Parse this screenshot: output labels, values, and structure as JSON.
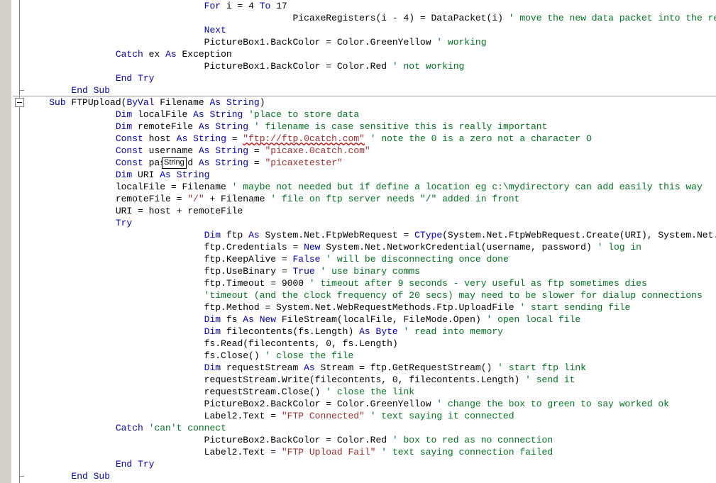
{
  "editor": {
    "language": "Visual Basic .NET",
    "gutter": {
      "indicator_margin_color": "#d4d0c8",
      "outline_rail_color": "#808080",
      "collapse_glyph": "minus-box"
    },
    "colors": {
      "background": "#ffffff",
      "keyword": "#0000C0",
      "comment": "#00731F",
      "string": "#9B2D2D",
      "identifier": "#000000",
      "error_squiggle": "#C00000",
      "separator": "#a0a0a0"
    }
  },
  "tooltip": {
    "text": "String",
    "kind": "quick-info"
  },
  "lines": [
    {
      "indent": 8,
      "tokens": [
        {
          "t": "For",
          "c": "kw"
        },
        {
          "t": " i = ",
          "c": "plain"
        },
        {
          "t": "4",
          "c": "plain"
        },
        {
          "t": " ",
          "c": "plain"
        },
        {
          "t": "To",
          "c": "kw"
        },
        {
          "t": " 17",
          "c": "plain"
        }
      ]
    },
    {
      "indent": 12,
      "tokens": [
        {
          "t": "PicaxeRegisters(i - 4) = DataPacket(i) ",
          "c": "plain"
        },
        {
          "t": "' move the new data packet into the register array",
          "c": "cmt"
        }
      ]
    },
    {
      "indent": 8,
      "tokens": [
        {
          "t": "Next",
          "c": "kw"
        }
      ]
    },
    {
      "indent": 8,
      "tokens": [
        {
          "t": "PictureBox1.BackColor = Color.GreenYellow ",
          "c": "plain"
        },
        {
          "t": "' working",
          "c": "cmt"
        }
      ]
    },
    {
      "indent": 4,
      "tokens": [
        {
          "t": "Catch",
          "c": "kw"
        },
        {
          "t": " ex ",
          "c": "plain"
        },
        {
          "t": "As",
          "c": "kw"
        },
        {
          "t": " Exception",
          "c": "plain"
        }
      ]
    },
    {
      "indent": 8,
      "tokens": [
        {
          "t": "PictureBox1.BackColor = Color.Red ",
          "c": "plain"
        },
        {
          "t": "' not working",
          "c": "cmt"
        }
      ]
    },
    {
      "indent": 4,
      "tokens": [
        {
          "t": "End Try",
          "c": "kw"
        }
      ]
    },
    {
      "indent": 2,
      "tokens": [
        {
          "t": "End Sub",
          "c": "kw"
        }
      ]
    },
    {
      "indent": 1,
      "tokens": [
        {
          "t": "Sub",
          "c": "kw"
        },
        {
          "t": " FTPUpload(",
          "c": "plain"
        },
        {
          "t": "ByVal",
          "c": "kw"
        },
        {
          "t": " Filename ",
          "c": "plain"
        },
        {
          "t": "As",
          "c": "kw"
        },
        {
          "t": " ",
          "c": "plain"
        },
        {
          "t": "String",
          "c": "kw"
        },
        {
          "t": ")",
          "c": "plain"
        }
      ]
    },
    {
      "indent": 4,
      "tokens": [
        {
          "t": "Dim",
          "c": "kw"
        },
        {
          "t": " localFile ",
          "c": "plain"
        },
        {
          "t": "As",
          "c": "kw"
        },
        {
          "t": " ",
          "c": "plain"
        },
        {
          "t": "String",
          "c": "kw"
        },
        {
          "t": " ",
          "c": "plain"
        },
        {
          "t": "'place to store data",
          "c": "cmt"
        }
      ]
    },
    {
      "indent": 4,
      "tokens": [
        {
          "t": "Dim",
          "c": "kw"
        },
        {
          "t": " remoteFile ",
          "c": "plain"
        },
        {
          "t": "As",
          "c": "kw"
        },
        {
          "t": " ",
          "c": "plain"
        },
        {
          "t": "String",
          "c": "kw"
        },
        {
          "t": " ",
          "c": "plain"
        },
        {
          "t": "' filename is case sensitive this is really important",
          "c": "cmt"
        }
      ]
    },
    {
      "indent": 4,
      "tokens": [
        {
          "t": "Const",
          "c": "kw"
        },
        {
          "t": " host ",
          "c": "plain"
        },
        {
          "t": "As",
          "c": "kw"
        },
        {
          "t": " ",
          "c": "plain"
        },
        {
          "t": "String",
          "c": "kw"
        },
        {
          "t": " = ",
          "c": "plain"
        },
        {
          "t": "\"ftp://ftp.0catch.com\"",
          "c": "str",
          "err": true
        },
        {
          "t": " ",
          "c": "plain"
        },
        {
          "t": "' note the 0 is a zero not a character O",
          "c": "cmt"
        }
      ]
    },
    {
      "indent": 4,
      "tokens": [
        {
          "t": "Const",
          "c": "kw"
        },
        {
          "t": " username ",
          "c": "plain"
        },
        {
          "t": "As",
          "c": "kw"
        },
        {
          "t": " ",
          "c": "plain"
        },
        {
          "t": "String",
          "c": "kw"
        },
        {
          "t": " = ",
          "c": "plain"
        },
        {
          "t": "\"picaxe.0catch.com\"",
          "c": "str"
        }
      ]
    },
    {
      "indent": 4,
      "tokens": [
        {
          "t": "Const",
          "c": "kw"
        },
        {
          "t": " password ",
          "c": "plain"
        },
        {
          "t": "As",
          "c": "kw"
        },
        {
          "t": " ",
          "c": "plain"
        },
        {
          "t": "String",
          "c": "kw"
        },
        {
          "t": " = ",
          "c": "plain"
        },
        {
          "t": "\"picaxetester\"",
          "c": "str"
        }
      ]
    },
    {
      "indent": 4,
      "tokens": [
        {
          "t": "Dim",
          "c": "kw"
        },
        {
          "t": " URI ",
          "c": "plain"
        },
        {
          "t": "As",
          "c": "kw"
        },
        {
          "t": " ",
          "c": "plain"
        },
        {
          "t": "String",
          "c": "kw"
        }
      ]
    },
    {
      "indent": 4,
      "tokens": [
        {
          "t": "localFile = Filename ",
          "c": "plain"
        },
        {
          "t": "' maybe not needed but if define a location eg c:\\mydirectory can add easily this way",
          "c": "cmt"
        }
      ]
    },
    {
      "indent": 4,
      "tokens": [
        {
          "t": "remoteFile = ",
          "c": "plain"
        },
        {
          "t": "\"/\"",
          "c": "str"
        },
        {
          "t": " + Filename ",
          "c": "plain"
        },
        {
          "t": "' file on ftp server needs \"/\" added in front",
          "c": "cmt"
        }
      ]
    },
    {
      "indent": 4,
      "tokens": [
        {
          "t": "URI = host + remoteFile",
          "c": "plain"
        }
      ]
    },
    {
      "indent": 4,
      "tokens": [
        {
          "t": "Try",
          "c": "kw"
        }
      ]
    },
    {
      "indent": 8,
      "tokens": [
        {
          "t": "Dim",
          "c": "kw"
        },
        {
          "t": " ftp ",
          "c": "plain"
        },
        {
          "t": "As",
          "c": "kw"
        },
        {
          "t": " System.Net.FtpWebRequest = ",
          "c": "plain"
        },
        {
          "t": "CType",
          "c": "kw"
        },
        {
          "t": "(System.Net.FtpWebRequest.Create(URI), System.Net.FtpWebRequest)",
          "c": "plain"
        }
      ]
    },
    {
      "indent": 8,
      "tokens": [
        {
          "t": "ftp.Credentials = ",
          "c": "plain"
        },
        {
          "t": "New",
          "c": "kw"
        },
        {
          "t": " System.Net.NetworkCredential(username, password) ",
          "c": "plain"
        },
        {
          "t": "' log in",
          "c": "cmt"
        }
      ]
    },
    {
      "indent": 8,
      "tokens": [
        {
          "t": "ftp.KeepAlive = ",
          "c": "plain"
        },
        {
          "t": "False",
          "c": "kw"
        },
        {
          "t": " ",
          "c": "plain"
        },
        {
          "t": "' will be disconnecting once done",
          "c": "cmt"
        }
      ]
    },
    {
      "indent": 8,
      "tokens": [
        {
          "t": "ftp.UseBinary = ",
          "c": "plain"
        },
        {
          "t": "True",
          "c": "kw"
        },
        {
          "t": " ",
          "c": "plain"
        },
        {
          "t": "' use binary comms",
          "c": "cmt"
        }
      ]
    },
    {
      "indent": 8,
      "tokens": [
        {
          "t": "ftp.Timeout = 9000 ",
          "c": "plain"
        },
        {
          "t": "' timeout after 9 seconds - very useful as ftp sometimes dies",
          "c": "cmt"
        }
      ]
    },
    {
      "indent": 8,
      "tokens": [
        {
          "t": "'timeout (and the clock frequency of 20 secs) may need to be slower for dialup connections",
          "c": "cmt"
        }
      ]
    },
    {
      "indent": 8,
      "tokens": [
        {
          "t": "ftp.Method = System.Net.WebRequestMethods.Ftp.UploadFile ",
          "c": "plain"
        },
        {
          "t": "' start sending file",
          "c": "cmt"
        }
      ]
    },
    {
      "indent": 8,
      "tokens": [
        {
          "t": "Dim",
          "c": "kw"
        },
        {
          "t": " fs ",
          "c": "plain"
        },
        {
          "t": "As",
          "c": "kw"
        },
        {
          "t": " ",
          "c": "plain"
        },
        {
          "t": "New",
          "c": "kw"
        },
        {
          "t": " FileStream(localFile, FileMode.Open) ",
          "c": "plain"
        },
        {
          "t": "' open local file",
          "c": "cmt"
        }
      ]
    },
    {
      "indent": 8,
      "tokens": [
        {
          "t": "Dim",
          "c": "kw"
        },
        {
          "t": " filecontents(fs.Length) ",
          "c": "plain"
        },
        {
          "t": "As",
          "c": "kw"
        },
        {
          "t": " ",
          "c": "plain"
        },
        {
          "t": "Byte",
          "c": "kw"
        },
        {
          "t": " ",
          "c": "plain"
        },
        {
          "t": "' read into memory",
          "c": "cmt"
        }
      ]
    },
    {
      "indent": 8,
      "tokens": [
        {
          "t": "fs.Read(filecontents, 0, fs.Length)",
          "c": "plain"
        }
      ]
    },
    {
      "indent": 8,
      "tokens": [
        {
          "t": "fs.Close() ",
          "c": "plain"
        },
        {
          "t": "' close the file",
          "c": "cmt"
        }
      ]
    },
    {
      "indent": 8,
      "tokens": [
        {
          "t": "Dim",
          "c": "kw"
        },
        {
          "t": " requestStream ",
          "c": "plain"
        },
        {
          "t": "As",
          "c": "kw"
        },
        {
          "t": " Stream = ftp.GetRequestStream() ",
          "c": "plain"
        },
        {
          "t": "' start ftp link",
          "c": "cmt"
        }
      ]
    },
    {
      "indent": 8,
      "tokens": [
        {
          "t": "requestStream.Write(filecontents, 0, filecontents.Length) ",
          "c": "plain"
        },
        {
          "t": "' send it",
          "c": "cmt"
        }
      ]
    },
    {
      "indent": 8,
      "tokens": [
        {
          "t": "requestStream.Close() ",
          "c": "plain"
        },
        {
          "t": "' close the link",
          "c": "cmt"
        }
      ]
    },
    {
      "indent": 8,
      "tokens": [
        {
          "t": "PictureBox2.BackColor = Color.GreenYellow ",
          "c": "plain"
        },
        {
          "t": "' change the box to green to say worked ok",
          "c": "cmt"
        }
      ]
    },
    {
      "indent": 8,
      "tokens": [
        {
          "t": "Label2.Text = ",
          "c": "plain"
        },
        {
          "t": "\"FTP Connected\"",
          "c": "str"
        },
        {
          "t": " ",
          "c": "plain"
        },
        {
          "t": "' text saying it connected",
          "c": "cmt"
        }
      ]
    },
    {
      "indent": 4,
      "tokens": [
        {
          "t": "Catch",
          "c": "kw"
        },
        {
          "t": " ",
          "c": "plain"
        },
        {
          "t": "'can't connect",
          "c": "cmt"
        }
      ]
    },
    {
      "indent": 8,
      "tokens": [
        {
          "t": "PictureBox2.BackColor = Color.Red ",
          "c": "plain"
        },
        {
          "t": "' box to red as no connection",
          "c": "cmt"
        }
      ]
    },
    {
      "indent": 8,
      "tokens": [
        {
          "t": "Label2.Text = ",
          "c": "plain"
        },
        {
          "t": "\"FTP Upload Fail\"",
          "c": "str"
        },
        {
          "t": " ",
          "c": "plain"
        },
        {
          "t": "' text saying connection failed",
          "c": "cmt"
        }
      ]
    },
    {
      "indent": 4,
      "tokens": [
        {
          "t": "End Try",
          "c": "kw"
        }
      ]
    },
    {
      "indent": 2,
      "tokens": [
        {
          "t": "End Sub",
          "c": "kw"
        }
      ]
    }
  ],
  "outlining": {
    "separators_at_lines": [
      8
    ],
    "collapse_boxes_at_lines": [
      8
    ],
    "ticks_at_lines": [
      7,
      39
    ]
  }
}
